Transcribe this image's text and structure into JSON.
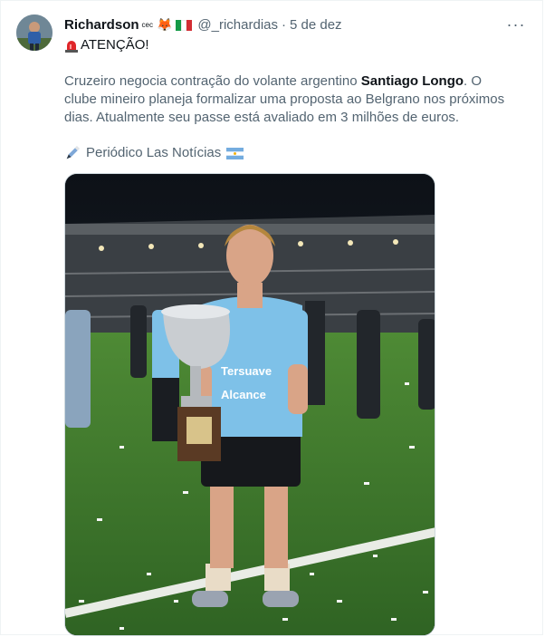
{
  "tweet": {
    "author": {
      "name": "Richardson",
      "name_sup": "cec",
      "handle": "@_richardias",
      "date": "5 de dez",
      "avatar": "avatar-image"
    },
    "more_icon": "more-horizontal-icon",
    "alert_text": "ATENÇÃO!",
    "body": {
      "part1": "Cruzeiro negocia contração do volante argentino ",
      "bold": "Santiago Longo",
      "part2": ". O clube mineiro planeja formalizar uma proposta ao Belgrano nos próximos dias. Atualmente seu passe está avaliado em 3 milhões de euros."
    },
    "source": "Periódico Las Notícias",
    "media": {
      "description": "Player holding a trophy on a stadium pitch",
      "shirt_sponsor_1": "Tersuave",
      "shirt_sponsor_2": "Alcance"
    }
  },
  "colors": {
    "text_primary": "#0f1419",
    "text_secondary": "#536471",
    "border": "#cfd9de",
    "jersey": "#7ec1e8",
    "pitch": "#3f7a2c"
  }
}
